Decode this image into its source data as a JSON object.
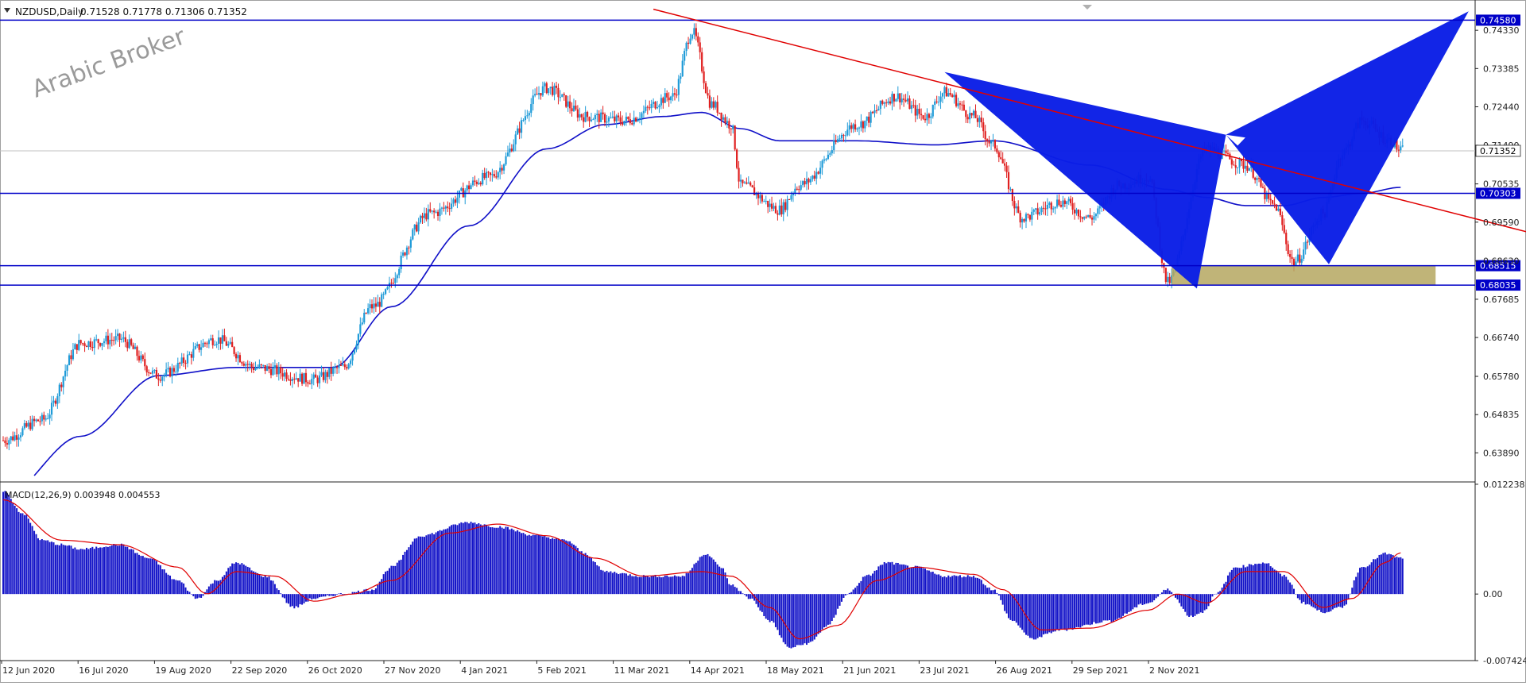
{
  "window": {
    "symbol_line": "NZDUSD,Daily",
    "ohlc": "0.71528 0.71778 0.71306 0.71352",
    "watermark": "Arabic Broker"
  },
  "colors": {
    "bull": "#1f9bd8",
    "bear": "#e02020",
    "ma": "#1010c8",
    "level": "#0000c8",
    "trendline": "#e00000",
    "pattern": "#0a1ee6",
    "zone": "#b5a760",
    "macd_hist": "#1414c8",
    "macd_signal": "#e00000"
  },
  "chart_data": [
    {
      "type": "candlestick",
      "symbol": "NZDUSD",
      "timeframe": "Daily",
      "last": {
        "open": 0.71528,
        "high": 0.71778,
        "low": 0.71306,
        "close": 0.71352
      },
      "current_price_label": "0.71352",
      "ylim": [
        0.6325,
        0.75
      ],
      "y_ticks": [
        "0.74330",
        "0.73385",
        "0.72440",
        "0.71490",
        "0.70535",
        "0.69590",
        "0.68630",
        "0.67685",
        "0.66740",
        "0.65780",
        "0.64835",
        "0.63890"
      ],
      "x_tick_labels": [
        "12 Jun 2020",
        "16 Jul 2020",
        "19 Aug 2020",
        "22 Sep 2020",
        "26 Oct 2020",
        "27 Nov 2020",
        "4 Jan 2021",
        "5 Feb 2021",
        "11 Mar 2021",
        "14 Apr 2021",
        "18 May 2021",
        "21 Jun 2021",
        "23 Jul 2021",
        "26 Aug 2021",
        "29 Sep 2021",
        "2 Nov 2021"
      ],
      "price_path_anchors": [
        [
          0,
          0.642
        ],
        [
          20,
          0.647
        ],
        [
          40,
          0.666
        ],
        [
          60,
          0.667
        ],
        [
          80,
          0.658
        ],
        [
          110,
          0.667
        ],
        [
          130,
          0.66
        ],
        [
          160,
          0.657
        ],
        [
          175,
          0.66
        ],
        [
          190,
          0.675
        ],
        [
          220,
          0.698
        ],
        [
          250,
          0.707
        ],
        [
          280,
          0.729
        ],
        [
          300,
          0.722
        ],
        [
          320,
          0.721
        ],
        [
          345,
          0.727
        ],
        [
          355,
          0.743
        ],
        [
          365,
          0.725
        ],
        [
          375,
          0.72
        ],
        [
          380,
          0.705
        ],
        [
          400,
          0.699
        ],
        [
          410,
          0.705
        ],
        [
          440,
          0.72
        ],
        [
          460,
          0.727
        ],
        [
          475,
          0.722
        ],
        [
          485,
          0.728
        ],
        [
          500,
          0.722
        ],
        [
          510,
          0.715
        ],
        [
          525,
          0.697
        ],
        [
          545,
          0.701
        ],
        [
          560,
          0.697
        ],
        [
          575,
          0.705
        ],
        [
          590,
          0.707
        ],
        [
          600,
          0.681
        ],
        [
          620,
          0.714
        ],
        [
          640,
          0.71
        ],
        [
          655,
          0.7
        ],
        [
          665,
          0.686
        ],
        [
          680,
          0.698
        ],
        [
          690,
          0.713
        ],
        [
          700,
          0.721
        ],
        [
          715,
          0.716
        ],
        [
          720,
          0.7135
        ]
      ],
      "moving_average_anchors": [
        [
          0,
          0.628
        ],
        [
          40,
          0.643
        ],
        [
          80,
          0.658
        ],
        [
          120,
          0.66
        ],
        [
          170,
          0.66
        ],
        [
          200,
          0.675
        ],
        [
          240,
          0.695
        ],
        [
          280,
          0.714
        ],
        [
          310,
          0.72
        ],
        [
          340,
          0.722
        ],
        [
          360,
          0.723
        ],
        [
          380,
          0.719
        ],
        [
          400,
          0.716
        ],
        [
          440,
          0.716
        ],
        [
          480,
          0.715
        ],
        [
          510,
          0.716
        ],
        [
          560,
          0.71
        ],
        [
          600,
          0.704
        ],
        [
          620,
          0.702
        ],
        [
          640,
          0.7
        ],
        [
          660,
          0.7
        ],
        [
          680,
          0.702
        ],
        [
          700,
          0.703
        ],
        [
          720,
          0.7045
        ]
      ],
      "levels": [
        {
          "value": 0.7458,
          "label": "0.74580"
        },
        {
          "value": 0.70303,
          "label": "0.70303"
        },
        {
          "value": 0.68515,
          "label": "0.68515"
        },
        {
          "value": 0.68035,
          "label": "0.68035"
        }
      ],
      "trendline": [
        [
          335,
          0.7485
        ],
        [
          920,
          0.677
        ]
      ],
      "harmonic_pattern": {
        "triangle_1": [
          [
            485,
            0.733
          ],
          [
            630,
            0.7175
          ],
          [
            615,
            0.6795
          ]
        ],
        "triangle_2": [
          [
            630,
            0.7175
          ],
          [
            755,
            0.748
          ],
          [
            683,
            0.6855
          ]
        ],
        "notch": [
          [
            630,
            0.7175
          ],
          [
            636,
            0.7148
          ],
          [
            640,
            0.7168
          ]
        ]
      },
      "demand_zone": {
        "x": [
          602,
          738
        ],
        "y": [
          0.68035,
          0.68515
        ]
      }
    },
    {
      "type": "histogram",
      "indicator": "MACD",
      "title": "MACD(12,26,9) 0.003948 0.004553",
      "ylim": [
        -0.00742,
        0.01223
      ],
      "y_ticks": [
        "0.012238",
        "0.00",
        "-0.007424"
      ],
      "histogram_anchors": [
        [
          0,
          0.0115
        ],
        [
          10,
          0.009
        ],
        [
          20,
          0.006
        ],
        [
          30,
          0.0055
        ],
        [
          40,
          0.005
        ],
        [
          60,
          0.0055
        ],
        [
          75,
          0.004
        ],
        [
          90,
          0.0015
        ],
        [
          100,
          -0.0005
        ],
        [
          110,
          0.0015
        ],
        [
          120,
          0.0035
        ],
        [
          135,
          0.002
        ],
        [
          150,
          -0.0015
        ],
        [
          160,
          -0.0005
        ],
        [
          175,
          0.0
        ],
        [
          190,
          0.0005
        ],
        [
          200,
          0.003
        ],
        [
          215,
          0.0065
        ],
        [
          240,
          0.008
        ],
        [
          255,
          0.0075
        ],
        [
          275,
          0.0065
        ],
        [
          290,
          0.006
        ],
        [
          300,
          0.0045
        ],
        [
          310,
          0.0025
        ],
        [
          330,
          0.002
        ],
        [
          350,
          0.002
        ],
        [
          362,
          0.0045
        ],
        [
          370,
          0.003
        ],
        [
          375,
          0.001
        ],
        [
          385,
          -0.0005
        ],
        [
          395,
          -0.003
        ],
        [
          405,
          -0.006
        ],
        [
          415,
          -0.0055
        ],
        [
          425,
          -0.0035
        ],
        [
          435,
          0.0
        ],
        [
          445,
          0.002
        ],
        [
          455,
          0.0035
        ],
        [
          470,
          0.003
        ],
        [
          485,
          0.002
        ],
        [
          500,
          0.002
        ],
        [
          510,
          0.0005
        ],
        [
          520,
          -0.003
        ],
        [
          530,
          -0.005
        ],
        [
          545,
          -0.004
        ],
        [
          570,
          -0.003
        ],
        [
          590,
          -0.001
        ],
        [
          600,
          0.0005
        ],
        [
          612,
          -0.0025
        ],
        [
          618,
          -0.002
        ],
        [
          625,
          0.0
        ],
        [
          635,
          0.003
        ],
        [
          650,
          0.0035
        ],
        [
          660,
          0.002
        ],
        [
          670,
          -0.001
        ],
        [
          680,
          -0.002
        ],
        [
          690,
          -0.0015
        ],
        [
          700,
          0.003
        ],
        [
          712,
          0.0045
        ],
        [
          720,
          0.004
        ]
      ],
      "signal_anchors": [
        [
          0,
          0.0105
        ],
        [
          30,
          0.006
        ],
        [
          60,
          0.0055
        ],
        [
          90,
          0.003
        ],
        [
          105,
          0.0
        ],
        [
          120,
          0.0025
        ],
        [
          140,
          0.002
        ],
        [
          160,
          -0.0008
        ],
        [
          180,
          0.0
        ],
        [
          200,
          0.0015
        ],
        [
          230,
          0.0068
        ],
        [
          255,
          0.0078
        ],
        [
          280,
          0.0065
        ],
        [
          305,
          0.004
        ],
        [
          330,
          0.002
        ],
        [
          360,
          0.0025
        ],
        [
          375,
          0.002
        ],
        [
          395,
          -0.0015
        ],
        [
          410,
          -0.005
        ],
        [
          430,
          -0.0035
        ],
        [
          450,
          0.0015
        ],
        [
          470,
          0.003
        ],
        [
          500,
          0.0022
        ],
        [
          515,
          0.0005
        ],
        [
          535,
          -0.004
        ],
        [
          560,
          -0.0038
        ],
        [
          590,
          -0.0018
        ],
        [
          605,
          0.0
        ],
        [
          620,
          -0.001
        ],
        [
          640,
          0.0025
        ],
        [
          660,
          0.0025
        ],
        [
          680,
          -0.0015
        ],
        [
          695,
          -0.0005
        ],
        [
          712,
          0.0035
        ],
        [
          720,
          0.0046
        ]
      ]
    }
  ]
}
